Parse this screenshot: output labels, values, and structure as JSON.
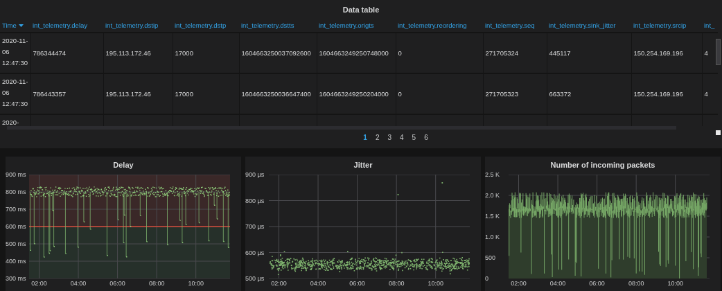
{
  "table": {
    "title": "Data table",
    "columns": [
      {
        "label": "Time",
        "sorted": true
      },
      {
        "label": "int_telemetry.delay",
        "sorted": false
      },
      {
        "label": "int_telemetry.dstip",
        "sorted": false
      },
      {
        "label": "int_telemetry.dstp",
        "sorted": false
      },
      {
        "label": "int_telemetry.dstts",
        "sorted": false
      },
      {
        "label": "int_telemetry.origts",
        "sorted": false
      },
      {
        "label": "int_telemetry.reordering",
        "sorted": false
      },
      {
        "label": "int_telemetry.seq",
        "sorted": false
      },
      {
        "label": "int_telemetry.sink_jitter",
        "sorted": false
      },
      {
        "label": "int_telemetry.srcip",
        "sorted": false
      },
      {
        "label": "int_",
        "sorted": false
      }
    ],
    "rows": [
      {
        "cells": [
          "2020-11-06 12:47:30",
          "786344474",
          "195.113.172.46",
          "17000",
          "1604663250037092600",
          "1604663249250748000",
          "0",
          "271705324",
          "445117",
          "150.254.169.196",
          "4"
        ]
      },
      {
        "cells": [
          "2020-11-06 12:47:30",
          "786443357",
          "195.113.172.46",
          "17000",
          "1604663250036647400",
          "1604663249250204000",
          "0",
          "271705323",
          "663372",
          "150.254.169.196",
          "4"
        ]
      },
      {
        "cells": [
          "2020-"
        ]
      }
    ],
    "pages": [
      {
        "label": "1",
        "selected": true
      },
      {
        "label": "2",
        "selected": false
      },
      {
        "label": "3",
        "selected": false
      },
      {
        "label": "4",
        "selected": false
      },
      {
        "label": "5",
        "selected": false
      },
      {
        "label": "6",
        "selected": false
      }
    ]
  },
  "panels": [
    {
      "title": "Delay",
      "kind": "threshold-points",
      "y_ticks": [
        "900 ms",
        "800 ms",
        "700 ms",
        "600 ms",
        "500 ms",
        "400 ms",
        "300 ms"
      ],
      "x_ticks": [
        "02:00",
        "04:00",
        "06:00",
        "08:00",
        "10:00"
      ]
    },
    {
      "title": "Jitter",
      "kind": "scatter",
      "y_ticks": [
        "900 µs",
        "800 µs",
        "700 µs",
        "600 µs",
        "500 µs"
      ],
      "x_ticks": [
        "02:00",
        "04:00",
        "06:00",
        "08:00",
        "10:00"
      ]
    },
    {
      "title": "Number of incoming packets",
      "kind": "area",
      "y_ticks": [
        "2.5 K",
        "2.0 K",
        "1.5 K",
        "1.0 K",
        "500",
        "0"
      ],
      "x_ticks": [
        "02:00",
        "04:00",
        "06:00",
        "08:00",
        "10:00"
      ]
    }
  ]
}
